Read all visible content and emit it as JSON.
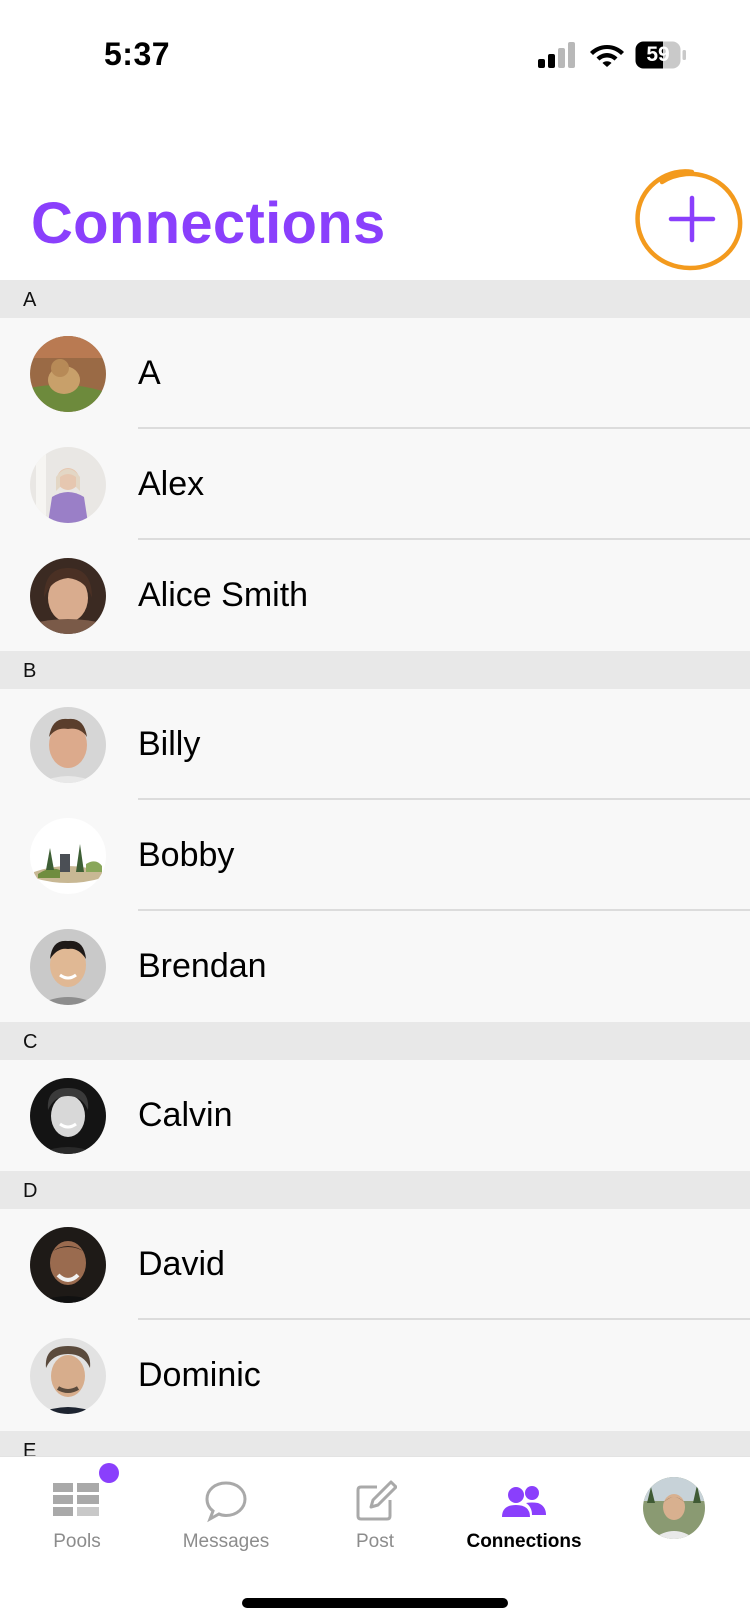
{
  "status_bar": {
    "time": "5:37",
    "battery": "59"
  },
  "header": {
    "title": "Connections",
    "add_icon": "plus-icon"
  },
  "colors": {
    "accent": "#8A3FFC",
    "annotation": "#F39A1D",
    "section_bg": "#E8E8E8",
    "row_bg": "#F8F8F8"
  },
  "sections": [
    {
      "letter": "A",
      "contacts": [
        {
          "name": "A"
        },
        {
          "name": "Alex"
        },
        {
          "name": "Alice Smith"
        }
      ]
    },
    {
      "letter": "B",
      "contacts": [
        {
          "name": "Billy"
        },
        {
          "name": "Bobby"
        },
        {
          "name": "Brendan"
        }
      ]
    },
    {
      "letter": "C",
      "contacts": [
        {
          "name": "Calvin"
        }
      ]
    },
    {
      "letter": "D",
      "contacts": [
        {
          "name": "David"
        },
        {
          "name": "Dominic"
        }
      ]
    },
    {
      "letter": "E",
      "contacts": []
    }
  ],
  "tab_bar": {
    "tabs": [
      {
        "label": "Pools",
        "icon": "grid-list-icon",
        "badge": true
      },
      {
        "label": "Messages",
        "icon": "chat-bubble-icon"
      },
      {
        "label": "Post",
        "icon": "compose-icon"
      },
      {
        "label": "Connections",
        "icon": "people-icon",
        "active": true
      },
      {
        "label": "",
        "icon": "profile-avatar"
      }
    ]
  }
}
